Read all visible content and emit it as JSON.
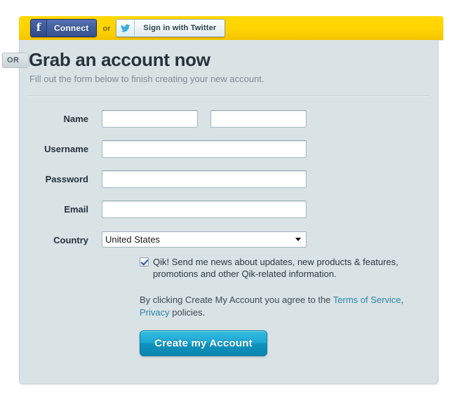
{
  "social_bar": {
    "facebook": {
      "icon": "facebook-f-icon",
      "label": "Connect"
    },
    "separator": "or",
    "twitter": {
      "icon": "twitter-bird-icon",
      "label": "Sign in with Twitter"
    },
    "background_color": "#ffd400"
  },
  "or_badge": {
    "label": "OR"
  },
  "panel": {
    "title": "Grab an account now",
    "subtitle": "Fill out the form below to finish creating your new account.",
    "background_color": "#d9e2e5"
  },
  "form": {
    "fields": [
      {
        "label": "Name",
        "type": "name-pair",
        "first_value": "",
        "first_placeholder": "",
        "last_value": "",
        "last_placeholder": ""
      },
      {
        "label": "Username",
        "type": "text",
        "value": "",
        "placeholder": ""
      },
      {
        "label": "Password",
        "type": "password",
        "value": "",
        "placeholder": ""
      },
      {
        "label": "Email",
        "type": "text",
        "value": "",
        "placeholder": ""
      },
      {
        "label": "Country",
        "type": "select",
        "value": "United States",
        "options": [
          "United States"
        ]
      }
    ],
    "newsletter": {
      "checked": true,
      "text": "Qik! Send me news about updates, new products & features, promotions and other Qik-related information."
    },
    "terms": {
      "prefix": "By clicking Create My Account you agree to the ",
      "link_terms": "Terms of Service",
      "middle": ", ",
      "link_privacy": "Privacy",
      "suffix": " policies.",
      "link_color": "#2a86a8"
    },
    "submit": {
      "label": "Create my Account",
      "color": "#1ba7d2"
    }
  }
}
